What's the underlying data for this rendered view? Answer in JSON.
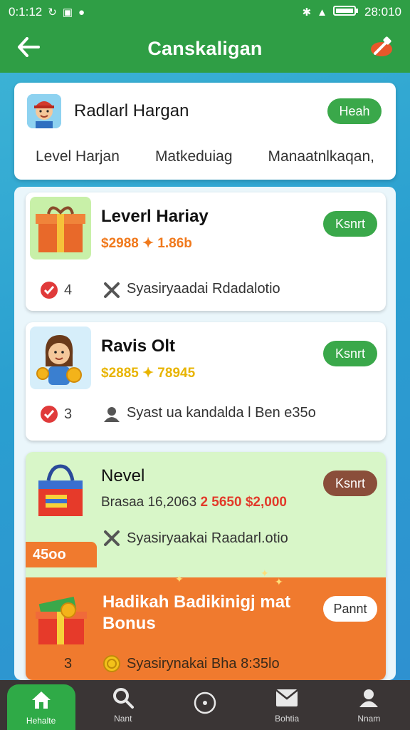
{
  "status_bar": {
    "time_left": "0:1:12",
    "time_right": "28:010",
    "left_icons": [
      "sync-icon",
      "image-icon",
      "dot-icon"
    ],
    "right_icons": [
      "bluetooth-icon",
      "signal-icon",
      "battery-icon"
    ]
  },
  "app_bar": {
    "title": "Canskaligan",
    "back_icon": "arrow-left-icon",
    "tool_icon": "hammer-icon"
  },
  "header": {
    "name": "Radlarl Hargan",
    "button_label": "Heah",
    "tabs": [
      "Level Harjan",
      "Matkeduiag",
      "Manaatnlkaqan,"
    ]
  },
  "items": [
    {
      "title": "Leverl Hariay",
      "price": "$2988 ✦ 1.86b",
      "button_label": "Ksnrt",
      "count": "4",
      "description": "Syasiryaadai Rdadalotio"
    },
    {
      "title": "Ravis Olt",
      "price": "$2885 ✦ 78945",
      "button_label": "Ksnrt",
      "count": "3",
      "description": "Syast ua kandalda l Ben e35o"
    },
    {
      "title": "Nevel",
      "price_prefix": "Brasaa 16,2063",
      "price_highlight": "2 5650 $2,000",
      "button_label": "Ksnrt",
      "description": "Syasiryaakai Raadarl.otio",
      "ribbon": "45oo",
      "bonus_title": "Hadikah Badikinigj mat Bonus",
      "bonus_button_label": "Pannt",
      "count": "3",
      "bonus_description": "Syasirynakai Bha 8:35lo"
    }
  ],
  "bottom_nav": [
    {
      "label": "Hehalte",
      "icon": "home-icon"
    },
    {
      "label": "Nant",
      "icon": "search-icon"
    },
    {
      "label": "",
      "icon": "compass-icon"
    },
    {
      "label": "Bohtia",
      "icon": "mail-icon"
    },
    {
      "label": "Nnam",
      "icon": "profile-icon"
    }
  ],
  "colors": {
    "primary_green": "#2f9e45",
    "button_green": "#3aa84a",
    "accent_orange": "#f07a2e",
    "price_orange": "#f0791c",
    "price_yellow": "#e8b400",
    "brown_button": "#8a4e3a"
  }
}
